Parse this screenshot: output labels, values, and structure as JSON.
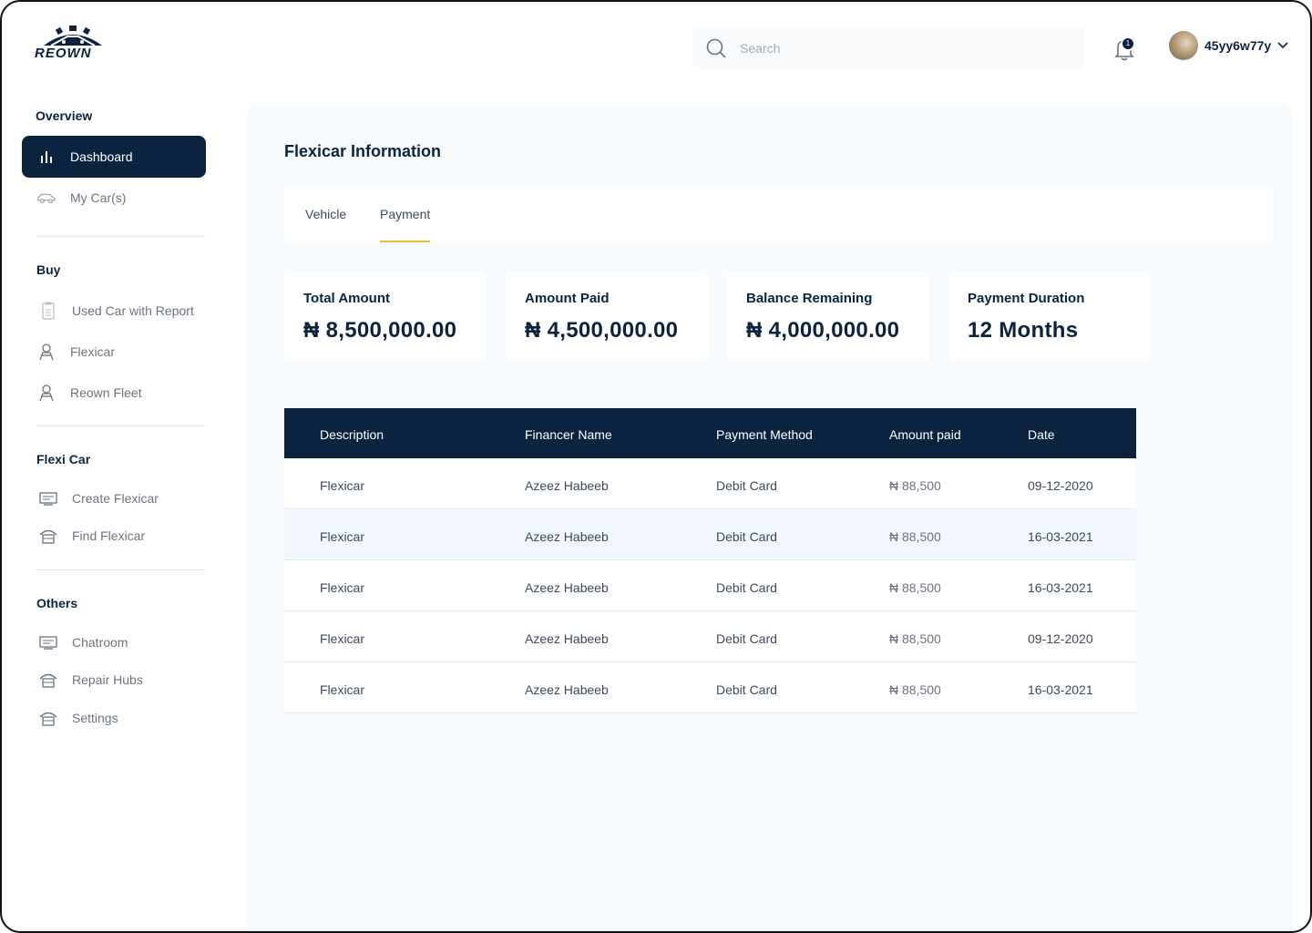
{
  "brand": {
    "name": "REOWN"
  },
  "header": {
    "search_placeholder": "Search",
    "notification_count": "1",
    "username": "45yy6w77y"
  },
  "sidebar": {
    "sections": [
      {
        "title": "Overview",
        "items": [
          {
            "label": "Dashboard",
            "icon": "bar-chart-icon",
            "active": true
          },
          {
            "label": "My Car(s)",
            "icon": "car-icon"
          }
        ]
      },
      {
        "title": "Buy",
        "items": [
          {
            "label": "Used Car with Report",
            "icon": "clipboard-icon"
          },
          {
            "label": "Flexicar",
            "icon": "person-icon"
          },
          {
            "label": "Reown Fleet",
            "icon": "person-icon"
          }
        ]
      },
      {
        "title": "Flexi Car",
        "items": [
          {
            "label": "Create Flexicar",
            "icon": "monitor-icon"
          },
          {
            "label": "Find Flexicar",
            "icon": "garage-icon"
          }
        ]
      },
      {
        "title": "Others",
        "items": [
          {
            "label": "Chatroom",
            "icon": "monitor-icon"
          },
          {
            "label": "Repair Hubs",
            "icon": "garage-icon"
          },
          {
            "label": "Settings",
            "icon": "garage-icon"
          }
        ]
      }
    ]
  },
  "main": {
    "title": "Flexicar Information",
    "tabs": [
      {
        "label": "Vehicle"
      },
      {
        "label": "Payment",
        "active": true
      }
    ],
    "cards": [
      {
        "label": "Total Amount",
        "value": "₦ 8,500,000.00"
      },
      {
        "label": "Amount Paid",
        "value": "₦ 4,500,000.00"
      },
      {
        "label": "Balance Remaining",
        "value": "₦ 4,000,000.00"
      },
      {
        "label": "Payment Duration",
        "value": "12 Months"
      }
    ],
    "table": {
      "columns": [
        "Description",
        "Financer Name",
        "Payment Method",
        "Amount paid",
        "Date"
      ],
      "rows": [
        [
          "Flexicar",
          "Azeez Habeeb",
          "Debit Card",
          "₦ 88,500",
          "09-12-2020"
        ],
        [
          "Flexicar",
          "Azeez Habeeb",
          "Debit Card",
          "₦ 88,500",
          "16-03-2021"
        ],
        [
          "Flexicar",
          "Azeez Habeeb",
          "Debit Card",
          "₦ 88,500",
          "16-03-2021"
        ],
        [
          "Flexicar",
          "Azeez Habeeb",
          "Debit Card",
          "₦ 88,500",
          "09-12-2020"
        ],
        [
          "Flexicar",
          "Azeez Habeeb",
          "Debit Card",
          "₦ 88,500",
          "16-03-2021"
        ]
      ]
    }
  },
  "colors": {
    "navy": "#0c2340",
    "accent": "#f0b93a",
    "row_highlight": "#f1f7fd"
  }
}
